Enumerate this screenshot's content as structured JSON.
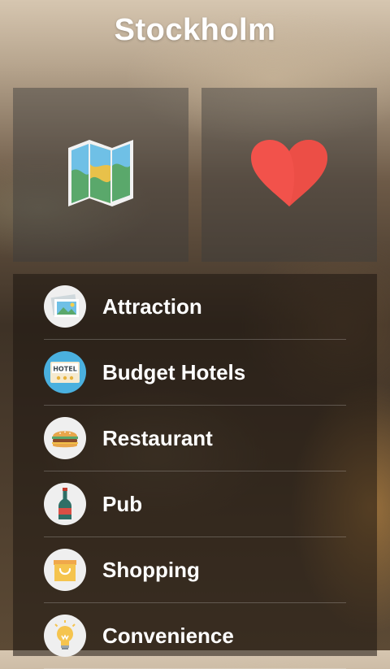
{
  "header": {
    "title": "Stockholm"
  },
  "tiles": [
    {
      "icon": "map-icon"
    },
    {
      "icon": "heart-icon"
    }
  ],
  "menu": {
    "items": [
      {
        "label": "Attraction",
        "icon": "picture-icon"
      },
      {
        "label": "Budget Hotels",
        "icon": "hotel-sign-icon"
      },
      {
        "label": "Restaurant",
        "icon": "burger-icon"
      },
      {
        "label": "Pub",
        "icon": "wine-bottle-icon"
      },
      {
        "label": "Shopping",
        "icon": "shopping-bag-icon"
      },
      {
        "label": "Convenience",
        "icon": "lightbulb-icon"
      }
    ]
  },
  "hotel_sign_text": "HOTEL",
  "colors": {
    "heart": "#f2524b",
    "hotel_circle": "#4ab0df",
    "title": "#ffffff"
  }
}
